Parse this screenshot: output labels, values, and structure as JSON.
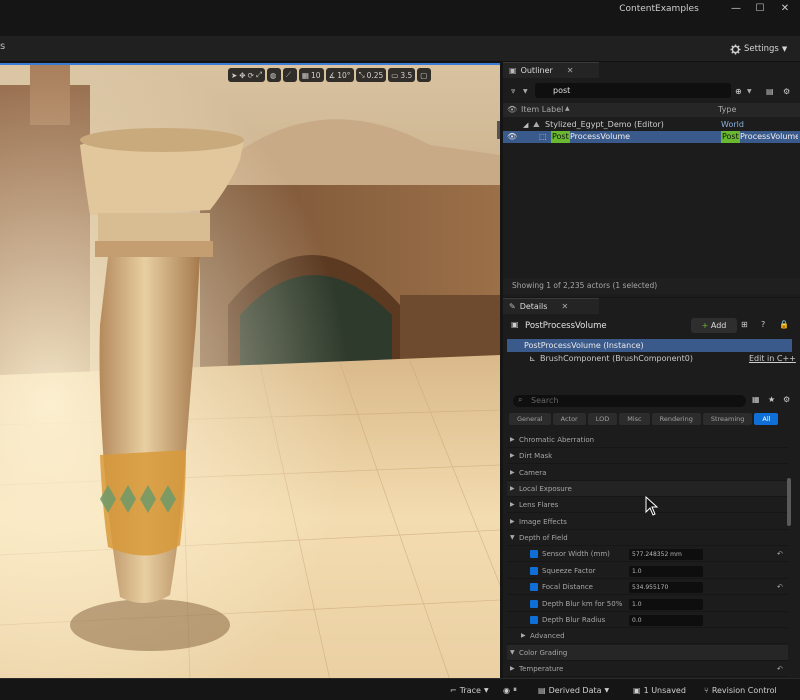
{
  "window": {
    "title": "ContentExamples",
    "minimize_glyph": "—",
    "maximize_glyph": "☐",
    "close_glyph": "✕"
  },
  "toolbar": {
    "left_chevron": "s",
    "settings_label": "Settings"
  },
  "viewport": {
    "grid_snap": "10",
    "rotation_snap": "10°",
    "scale_snap": "0.25",
    "camera_speed": "3.5"
  },
  "outliner": {
    "tab_label": "Outliner",
    "search_value": "post",
    "columns": {
      "label": "Item Label",
      "type": "Type"
    },
    "rows": [
      {
        "label": "Stylized_Egypt_Demo (Editor)",
        "type": "World"
      },
      {
        "label_highlight": "Post",
        "label_rest": "ProcessVolume",
        "type_highlight": "Post",
        "type_rest": "ProcessVolume"
      }
    ],
    "status": "Showing 1 of 2,235 actors (1 selected)"
  },
  "details": {
    "tab_label": "Details",
    "actor_name": "PostProcessVolume",
    "add_label": "Add",
    "instance_label": "PostProcessVolume (Instance)",
    "component_label": "BrushComponent (BrushComponent0)",
    "edit_link": "Edit in C++",
    "search_placeholder": "Search",
    "categories": [
      "General",
      "Actor",
      "LOD",
      "Misc",
      "Rendering",
      "Streaming",
      "All"
    ],
    "rows": [
      {
        "label": "Chromatic Aberration"
      },
      {
        "label": "Dirt Mask"
      },
      {
        "label": "Camera"
      },
      {
        "label": "Local Exposure"
      },
      {
        "label": "Lens Flares"
      },
      {
        "label": "Image Effects"
      },
      {
        "label": "Depth of Field"
      },
      {
        "label": "Sensor Width (mm)",
        "value": "577.248352 mm"
      },
      {
        "label": "Squeeze Factor",
        "value": "1.0"
      },
      {
        "label": "Focal Distance",
        "value": "534.955170"
      },
      {
        "label": "Depth Blur km for 50%",
        "value": "1.0"
      },
      {
        "label": "Depth Blur Radius",
        "value": "0.0"
      },
      {
        "label": "Advanced"
      },
      {
        "label": "Color Grading"
      },
      {
        "label": "Temperature"
      }
    ]
  },
  "statusbar": {
    "trace": "Trace",
    "derived_data": "Derived Data",
    "unsaved": "1 Unsaved",
    "revision_control": "Revision Control"
  },
  "colors": {
    "accent_blue": "#0f6fd6",
    "selection_row": "#3a5a8c",
    "search_highlight": "#6ab832",
    "panel_bg": "#1c1c1c"
  }
}
